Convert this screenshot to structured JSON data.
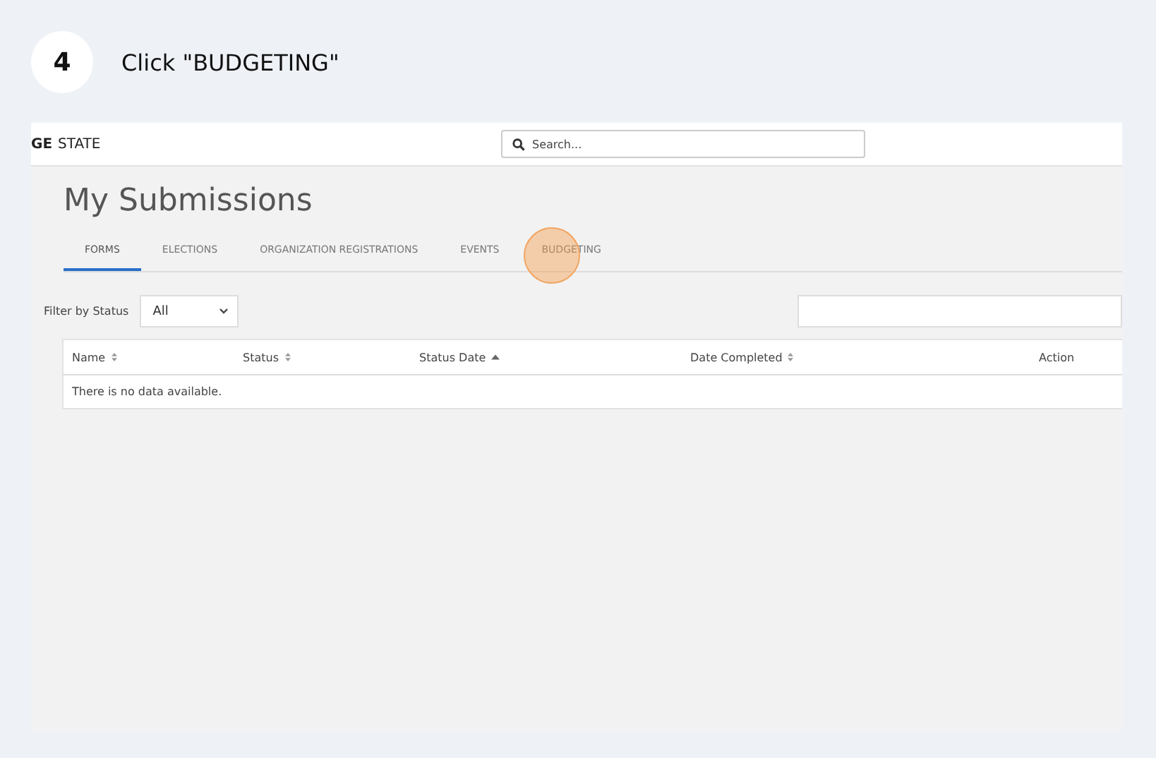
{
  "step": {
    "number": "4",
    "instruction": "Click \"BUDGETING\""
  },
  "header": {
    "logo_bold": "GE",
    "logo_text": "STATE",
    "search": {
      "placeholder": "Search..."
    }
  },
  "page_title": "My Submissions",
  "tabs": [
    {
      "label": "FORMS",
      "selected": true
    },
    {
      "label": "ELECTIONS",
      "selected": false
    },
    {
      "label": "ORGANIZATION REGISTRATIONS",
      "selected": false
    },
    {
      "label": "EVENTS",
      "selected": false
    },
    {
      "label": "BUDGETING",
      "selected": false,
      "click_target": true
    }
  ],
  "filter": {
    "label": "Filter by Status",
    "value": "All"
  },
  "table": {
    "columns": [
      {
        "label": "Name",
        "sortable": true,
        "sorted_ascending": false
      },
      {
        "label": "Status",
        "sortable": true,
        "sorted_ascending": false
      },
      {
        "label": "Status Date",
        "sortable": true,
        "sorted_ascending": true
      },
      {
        "label": "Date Completed",
        "sortable": true,
        "sorted_ascending": false
      },
      {
        "label": "Action",
        "sortable": false
      }
    ],
    "empty_message": "There is no data available."
  }
}
